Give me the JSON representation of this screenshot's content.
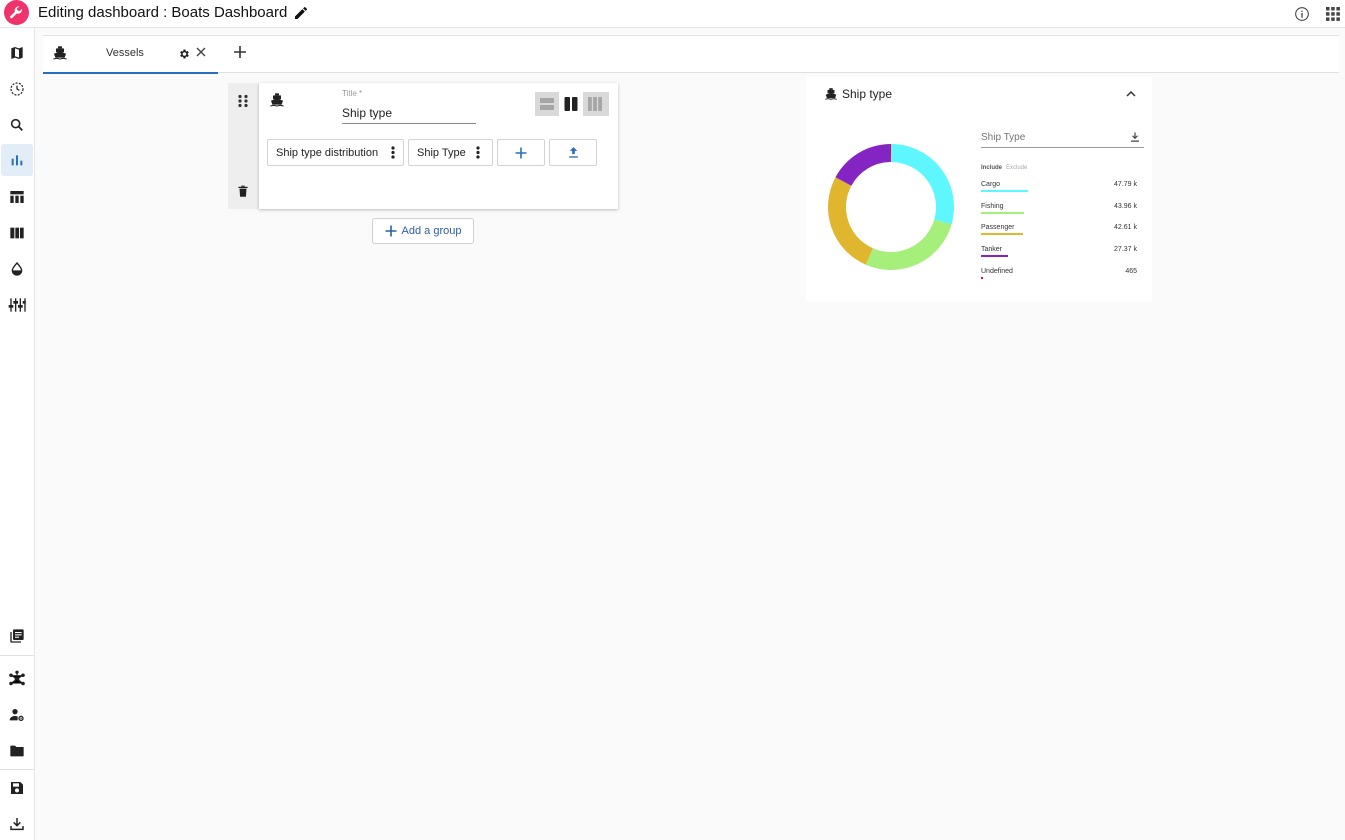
{
  "header": {
    "title": "Editing dashboard : Boats Dashboard"
  },
  "sidebar": {
    "top_items": [
      "map",
      "history",
      "search",
      "charts",
      "table",
      "columns",
      "water-drop",
      "filters"
    ],
    "bottom_items": [
      "library",
      "graph",
      "user-settings",
      "folder",
      "save",
      "download"
    ],
    "active": "charts"
  },
  "tabs": [
    {
      "label": "Vessels",
      "icon": "ship-icon",
      "active": true
    }
  ],
  "group": {
    "title_label": "Title *",
    "title_value": "Ship type",
    "layout_options": [
      "rows",
      "two-columns",
      "three-columns"
    ],
    "selected_layout": "two-columns",
    "chips": [
      {
        "label": "Ship type distribution"
      },
      {
        "label": "Ship Type"
      }
    ]
  },
  "add_group_label": "Add a group",
  "preview": {
    "title": "Ship type",
    "filter_placeholder": "Ship Type",
    "include_label": "Include",
    "exclude_label": "Exclude",
    "legend": [
      {
        "name": "Cargo",
        "value_label": "47.79 k",
        "color": "#5ef7ff"
      },
      {
        "name": "Fishing",
        "value_label": "43.96 k",
        "color": "#a7ef7b"
      },
      {
        "name": "Passenger",
        "value_label": "42.61 k",
        "color": "#e1b62f"
      },
      {
        "name": "Tanker",
        "value_label": "27.37 k",
        "color": "#8424c2"
      },
      {
        "name": "Undefined",
        "value_label": "465",
        "color": "#e4003e"
      }
    ]
  },
  "chart_data": {
    "type": "pie",
    "categories": [
      "Cargo",
      "Fishing",
      "Passenger",
      "Tanker",
      "Undefined"
    ],
    "values": [
      47790,
      43960,
      42610,
      27370,
      465
    ],
    "colors": [
      "#5ef7ff",
      "#a7ef7b",
      "#e1b62f",
      "#8424c2",
      "#e4003e"
    ],
    "donut": true
  }
}
